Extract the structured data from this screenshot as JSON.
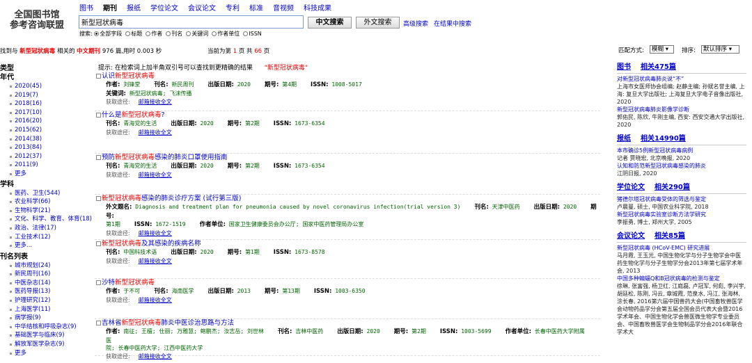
{
  "logo": {
    "line1": "全国图书馆",
    "line2": "参考咨询联盟"
  },
  "nav": [
    "图书",
    "期刊",
    "报纸",
    "学位论文",
    "会议论文",
    "专利",
    "标准",
    "音视频",
    "科技成果"
  ],
  "nav_active": 1,
  "search": {
    "value": "新型冠状病毒",
    "btn_zh": "中文搜索",
    "btn_en": "外文搜索",
    "adv": "高级搜索",
    "within": "在结果中搜索"
  },
  "fields": {
    "label": "搜索:",
    "options": [
      "全部字段",
      "标题",
      "作者",
      "刊名",
      "关键词",
      "作者单位",
      "ISSN"
    ],
    "selected": 0
  },
  "stats": {
    "prefix": "找到与",
    "term": "新型冠状病毒",
    "mid": "相关的",
    "scope": "中文期刊",
    "count": "976",
    "unit": "篇,用时",
    "time": "0.003",
    "sec": "秒"
  },
  "pager": {
    "pre": "当前为第",
    "cur": "1",
    "mid": "页 共",
    "total": "66",
    "post": "页"
  },
  "match": {
    "label": "匹配方式:",
    "value": "模糊"
  },
  "sort": {
    "label": "排序:",
    "value": "默认排序"
  },
  "facets": [
    {
      "title": "类型",
      "items": []
    },
    {
      "title": "年代",
      "items": [
        "2020(45)",
        "2019(7)",
        "2018(16)",
        "2017(10)",
        "2016(20)",
        "2015(62)",
        "2014(38)",
        "2013(84)",
        "2012(37)",
        "2011(9)",
        "更多"
      ]
    },
    {
      "title": "学科",
      "items": [
        "医药、卫生(544)",
        "农业科学(66)",
        "生物科学(21)",
        "文化、科学、教育、体育(18)",
        "政治、法律(17)",
        "工业技术(12)",
        "更多..."
      ]
    },
    {
      "title": "刊名列表",
      "items": [
        "城市规划(24)",
        "新民周刊(16)",
        "中医杂志(14)",
        "医药导报(13)",
        "护理研究(12)",
        "上海医学(11)",
        "病学报(9)",
        "中华结核和呼吸杂志(9)",
        "基础医学与临床(9)",
        "解放军医学杂志(9)",
        "更多"
      ]
    }
  ],
  "hint": {
    "text": "提示: 在检索词上加半角双引号可以查找到更精确的结果",
    "example": "\"新型冠状病毒\""
  },
  "results": [
    {
      "pre": "认识",
      "hl": "新型冠状病毒",
      "post": "",
      "lines": [
        [
          {
            "k": "作者:",
            "v": "刘锋堂"
          },
          {
            "k": "刊名:",
            "v": "新民周刊"
          },
          {
            "k": "出版日期:",
            "v": "2020"
          },
          {
            "k": "期号:",
            "v": "第4期"
          },
          {
            "k": "ISSN:",
            "v": "1008-5017"
          }
        ],
        [
          {
            "k": "关键词:",
            "v": "新型冠状病毒; 飞沫传播"
          }
        ]
      ],
      "get": "邮箱接收全文"
    },
    {
      "pre": "什么是",
      "hl": "新型冠状病毒",
      "post": "?",
      "lines": [
        [
          {
            "k": "刊名:",
            "v": "青海党的生活"
          },
          {
            "k": "出版日期:",
            "v": "2020"
          },
          {
            "k": "期号:",
            "v": "第2期"
          },
          {
            "k": "ISSN:",
            "v": "1673-6354"
          }
        ]
      ],
      "get": "邮箱接收全文"
    },
    {
      "pre": "预防",
      "hl": "新型冠状病毒",
      "post": "感染的肺炎口罩使用指南",
      "lines": [
        [
          {
            "k": "刊名:",
            "v": "青海党的生活"
          },
          {
            "k": "出版日期:",
            "v": "2020"
          },
          {
            "k": "期号:",
            "v": "第2期"
          },
          {
            "k": "ISSN:",
            "v": "1673-6354"
          }
        ]
      ],
      "get": "邮箱接收全文"
    },
    {
      "pre": "",
      "hl": "新型冠状病毒",
      "post": "感染的肺炎诊疗方案 (试行第三版)",
      "lines": [
        [
          {
            "k": "外文题名:",
            "v": "Diagnosis and treatment plan for pneumonia caused by novel coronavirus infection(trial version 3)"
          },
          {
            "k": "刊名:",
            "v": "天津中医药"
          },
          {
            "k": "出版日期:",
            "v": "2020"
          },
          {
            "k": "期号:",
            "v": ""
          }
        ],
        [
          {
            "k": "",
            "v": "第1期"
          },
          {
            "k": "ISSN:",
            "v": "1672-1519"
          },
          {
            "k": "作者单位:",
            "v": "国家卫生健康委员会办公厅; 国家中医药管理局办公室"
          }
        ]
      ],
      "get": "邮箱接收全文"
    },
    {
      "pre": "",
      "hl": "新型冠状病毒",
      "post": "及其感染的疾病名称",
      "lines": [
        [
          {
            "k": "刊名:",
            "v": "中国科技术语"
          },
          {
            "k": "出版日期:",
            "v": "2020"
          },
          {
            "k": "期号:",
            "v": "第1期"
          },
          {
            "k": "ISSN:",
            "v": "1673-8578"
          }
        ]
      ],
      "get": "邮箱接收全文"
    },
    {
      "pre": "沙特",
      "hl": "新型冠状病毒",
      "post": "",
      "lines": [
        [
          {
            "k": "作者:",
            "v": "于不可"
          },
          {
            "k": "刊名:",
            "v": "海南医学"
          },
          {
            "k": "出版日期:",
            "v": "2013"
          },
          {
            "k": "期号:",
            "v": "第13期"
          },
          {
            "k": "ISSN:",
            "v": "1003-6350"
          }
        ]
      ],
      "get": "邮箱接收全文"
    },
    {
      "pre": "吉林省",
      "hl": "新型冠状病毒",
      "post": "肺炎中医诊治思路与方法",
      "lines": [
        [
          {
            "k": "作者:",
            "v": "南征; 王檀; 仕丽; 万雅慧; 鲍鹏杰; 汝志岳; 刘世林"
          },
          {
            "k": "刊名:",
            "v": "吉林中医药"
          },
          {
            "k": "出版日期:",
            "v": "2020"
          },
          {
            "k": "期号:",
            "v": "第2期"
          },
          {
            "k": "ISSN:",
            "v": "1003-5699"
          },
          {
            "k": "作者单位:",
            "v": "长春中医药大学附属医"
          }
        ],
        [
          {
            "k": "",
            "v": "院; 长春中医药大学; 江西中医药大学"
          }
        ]
      ],
      "get": "邮箱接收全文"
    }
  ],
  "right": [
    {
      "h1": "图书",
      "h2": "相关475篇",
      "items": [
        {
          "t": "对新型冠状病毒肺炎说“不”",
          "s": "上海市女医师协会组编; 赵静主编; 孙斌名誉主编, 上海: 复旦大学出版社; 上海复旦大学电子音像出版社, 2020"
        },
        {
          "t": "新型冠状病毒肺炎影像学诊断",
          "s": "郭佑民, 陈欣, 牛刚主编, 西安: 西安交通大学出版社, 2020"
        }
      ]
    },
    {
      "h1": "报纸",
      "h2": "相关14990篇",
      "items": [
        {
          "t": "本市确诊5例新型冠状病毒病例",
          "s": "记者 贾晓宏, 北京晚报, 2020"
        },
        {
          "t": "认知和防范新型冠状病毒感染的肺炎",
          "s": "江阴日报, 2020"
        }
      ]
    },
    {
      "h1": "学位论文",
      "h2": "相关290篇",
      "items": [
        {
          "t": "猪德尔塔冠状病毒受体的筛选与鉴定",
          "s": "卢晨曼, 硕士, 中国农业科学院, 2018"
        },
        {
          "t": "新型冠状病毒实验室诊断方法学研究",
          "s": "李振勇, 博士, 郑州大学, 2005"
        }
      ]
    },
    {
      "h1": "会议论文",
      "h2": "相关85篇",
      "items": [
        {
          "t": "新型冠状病毒 (HCoV-EMC) 研究进展",
          "s": "马月霞, 王玉光, 中国生物化学与分子生物学会中医药生物化学与分子生物学分会2013年第七届学术年会, 2013"
        },
        {
          "t": "中国多种蝙蝠Q和B冠状病毒的检测与鉴定",
          "s": "徐琳, 张富强, 杨卫红, 江庭磊, 卢冠军, 何彪, 李兴宇, 胡廷松, 陈刚, 冯云, 章城霞, 范泉水, 冯江, 张海林, 涂长春, 2016第六届中国兽药大会(中国畜牧兽医学会动物药品学分会第五届全国会员代表大会暨2016学术年会、中国生物化学会兽医微生物学专业委员会、中国畜牧兽医学会生物制品学分会2016年联合学术大"
        }
      ]
    }
  ]
}
